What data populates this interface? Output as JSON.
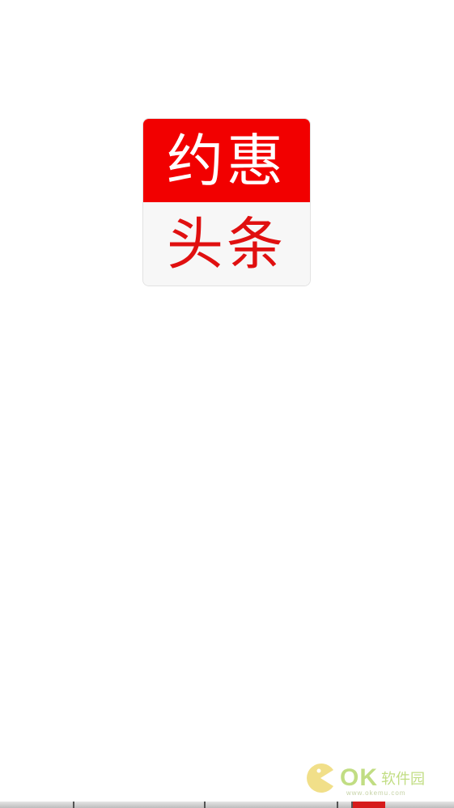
{
  "logo": {
    "top_text": "约惠",
    "bottom_text": "头条",
    "top_bg_color": "#f20000",
    "bottom_text_color": "#e01010"
  },
  "watermark": {
    "icon": "pacman-icon",
    "ok_text": "OK",
    "name_text": "软件园",
    "url_text": "www.okemu.com",
    "color": "#8fc21e"
  }
}
